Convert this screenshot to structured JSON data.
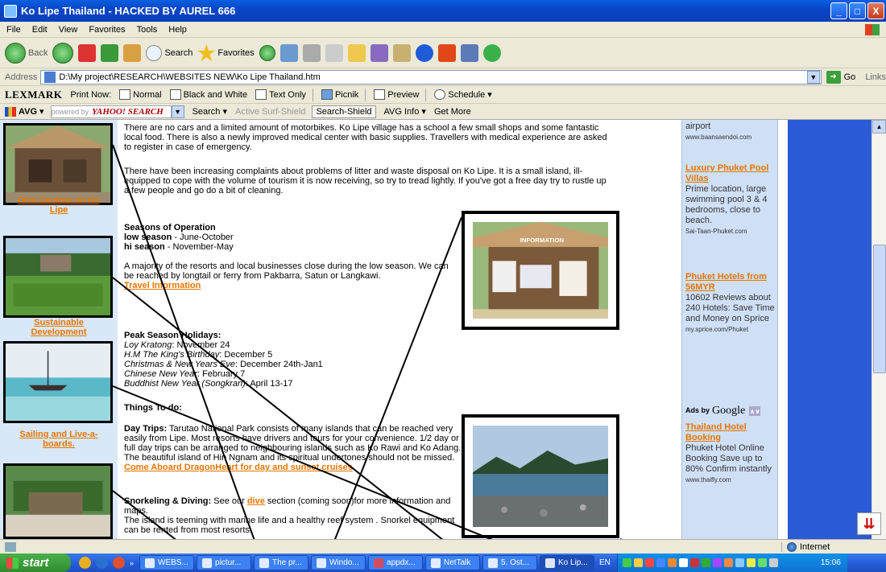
{
  "window": {
    "title": "Ko Lipe Thailand - HACKED BY AUREL 666",
    "minimize": "_",
    "maximize": "□",
    "close": "X"
  },
  "menu": [
    "File",
    "Edit",
    "View",
    "Favorites",
    "Tools",
    "Help"
  ],
  "toolbar": {
    "back": "Back",
    "search": "Search",
    "favorites": "Favorites"
  },
  "address": {
    "label": "Address",
    "value": "D:\\My project\\RESEARCH\\WEBSITES NEW\\Ko Lipe Thailand.htm",
    "go": "Go",
    "links": "Links"
  },
  "lexmark": {
    "logo": "LEXMARK",
    "print_now": "Print Now:",
    "normal": "Normal",
    "bw": "Black and White",
    "text_only": "Text Only",
    "picnik": "Picnik",
    "preview": "Preview",
    "schedule": "Schedule"
  },
  "avg": {
    "logo": "AVG",
    "powered": "powered by",
    "yahoo": "YAHOO! SEARCH",
    "search": "Search",
    "active": "Active Surf-Shield",
    "shield": "Search-Shield",
    "info": "AVG Info",
    "more": "Get More"
  },
  "sidebar": {
    "captions": [
      {
        "l1": "Dive Centres on Ko",
        "l2": "Lipe"
      },
      {
        "l1": "Sustainable",
        "l2": "Development"
      },
      {
        "l1": "Sailing and Live-a-",
        "l2": "boards."
      }
    ]
  },
  "content": {
    "p1": "There are no cars and a limited amount of motorbikes. Ko Lipe village has a school a few small shops and some fantastic local food. There is also a newly improved medical center with basic supplies. Travellers with medical experience are asked to register in case of emergency.",
    "p2": "There have been increasing complaints about problems of litter and waste disposal on Ko Lipe. It is a small island, ill-equipped to cope with the volume of tourism it is now receiving, so try to tread lightly. If you've got a free day try to rustle up a few people and go do a bit of cleaning.",
    "seasons_heading": "Seasons of Operation",
    "low_label": "low season",
    "low_value": " - June-October",
    "hi_label": "hi season",
    "hi_value": " - November-May",
    "p3": "A majority of the resorts and local businesses close during the low season. We can be reached by longtail or ferry from Pakbarra, Satun or Langkawi.",
    "travel_link": "Travel Information",
    "peak_heading": "Peak Season Holidays:",
    "h1_label": "Loy Kratong",
    "h1_value": ": November 24",
    "h2_label": "H.M The King's Birthday",
    "h2_value": ": December 5",
    "h3_label": "Christmas & New Years Eve",
    "h3_value": ": December 24th-Jan1",
    "h4_label": "Chinese New Year",
    "h4_value": ": February 7",
    "h5_label": "Buddhist New Year (Songkran)",
    "h5_value": ": April 13-17",
    "things_heading": "Things To do:",
    "day_label": "Day Trips:",
    "day_text": " Tarutao National Park consists of many islands that can be reached very easily from Lipe. Most resorts have drivers and tours for your convenience. 1/2 day or full day trips can be arranged to neighbouring islands such as Ko Rawi and Ko Adang. The beautiful island of Hin Ngnam and its spiritual undertones should not be missed.",
    "cruise_link": "Come Aboard DragonHeart for day and sunset cruises",
    "snork_label": "Snorkeling & Diving:",
    "snork_pre": " See our ",
    "dive_link": "dive",
    "snork_post": " section (coming soon)for more information and maps.",
    "snork_text2": "The island is teeming with marine life and a healthy reef system . Snorkel equipment can be rented from most resorts.",
    "info_sign": "INFORMATION"
  },
  "ads": {
    "a0_text": "airport",
    "a0_url": "www.baansaendoi.com",
    "a1_title": "Luxury Phuket Pool Villas",
    "a1_text": "Prime location, large swimming pool 3 & 4 bedrooms, close to beach.",
    "a1_url": "Sai-Taan-Phuket.com",
    "a2_title": "Phuket Hotels from 56MYR",
    "a2_text": "10602 Reviews about 240 Hotels: Save Time and Money on Sprice",
    "a2_url": "my.sprice.com/Phuket",
    "ads_by": "Ads by",
    "google": "Google",
    "a3_title": "Thailand Hotel Booking",
    "a3_text": "Phuket Hotel Online Booking Save up to 80% Confirm instantly",
    "a3_url": "www.thaifly.com"
  },
  "status": {
    "zone": "Internet"
  },
  "taskbar": {
    "start": "start",
    "tasks": [
      "WEBS...",
      "pictur...",
      "The pr...",
      "Windo...",
      "appdx...",
      "NetTalk",
      "5. Ost...",
      "Ko Lip..."
    ],
    "lang": "EN",
    "clock": "15:06"
  }
}
